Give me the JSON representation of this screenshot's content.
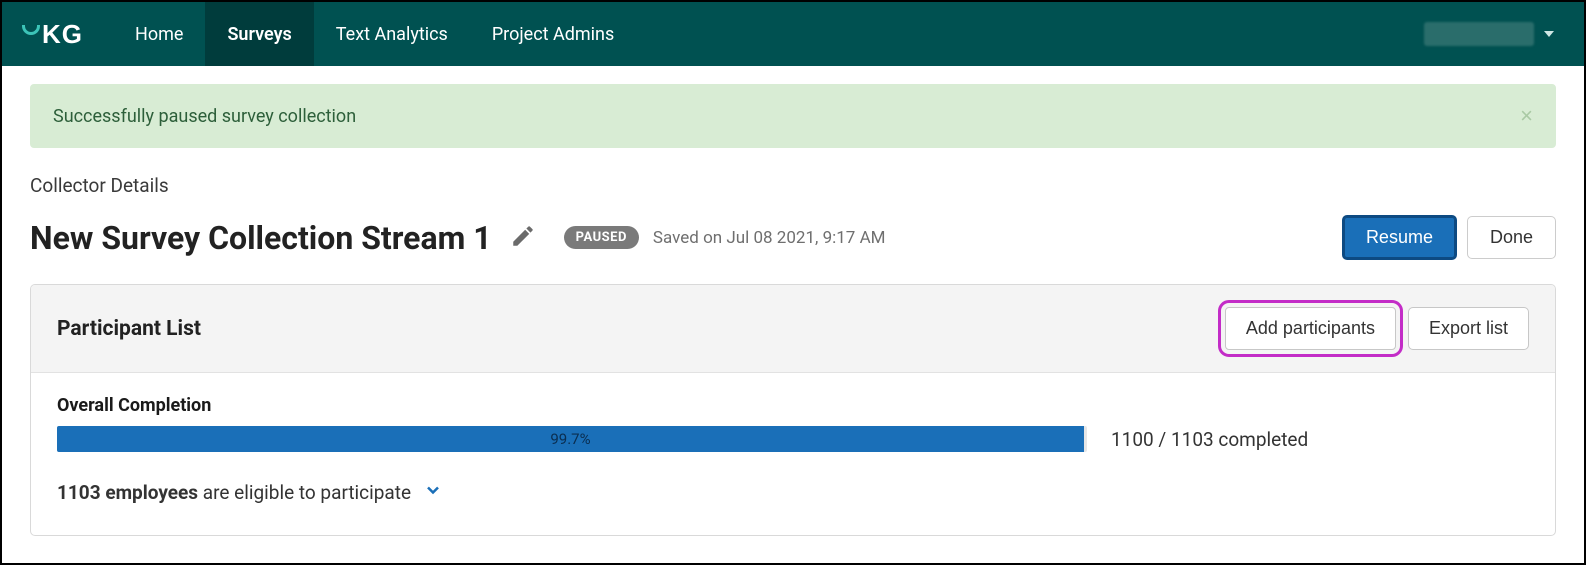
{
  "nav": {
    "items": [
      "Home",
      "Surveys",
      "Text Analytics",
      "Project Admins"
    ],
    "active_index": 1
  },
  "alert": {
    "message": "Successfully paused survey collection"
  },
  "section_label": "Collector Details",
  "page_title": "New Survey Collection Stream 1",
  "status_badge": "PAUSED",
  "saved_text": "Saved on Jul 08 2021, 9:17 AM",
  "buttons": {
    "resume": "Resume",
    "done": "Done"
  },
  "panel": {
    "title": "Participant List",
    "add_participants": "Add participants",
    "export_list": "Export list"
  },
  "completion": {
    "label": "Overall Completion",
    "percent_text": "99.7%",
    "percent_value": 99.7,
    "count_text": "1100 / 1103 completed"
  },
  "eligible": {
    "bold": "1103 employees",
    "rest": " are eligible to participate"
  }
}
